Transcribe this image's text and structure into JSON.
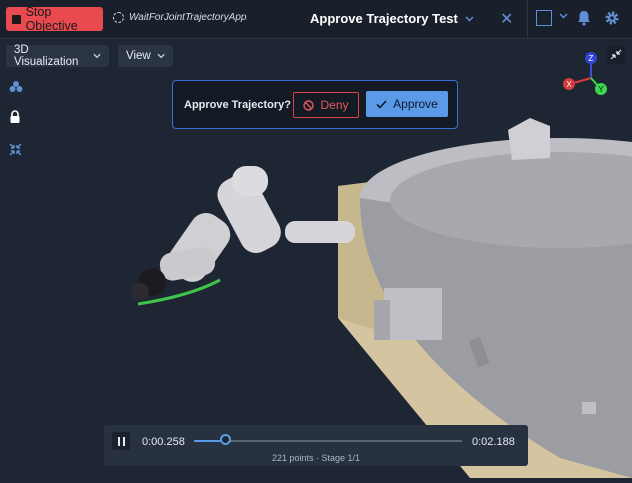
{
  "topbar": {
    "stop_label": "Stop Objective",
    "wait_status": "WaitForJointTrajectoryApproval",
    "title": "Approve Trajectory Test"
  },
  "toolbar": {
    "view_mode": "3D Visualization",
    "view_menu": "View"
  },
  "sidebar_icons": [
    "cluster-icon",
    "lock-icon",
    "collapse-icon"
  ],
  "dialog": {
    "question": "Approve Trajectory?",
    "deny_label": "Deny",
    "approve_label": "Approve"
  },
  "gizmo": {
    "x": "X",
    "y": "Y",
    "z": "Z"
  },
  "playback": {
    "current_time": "0:00.258",
    "end_time": "0:02.188",
    "progress": 0.118,
    "info": "221 points · Stage 1/1"
  },
  "colors": {
    "stop": "#e84a4f",
    "accent": "#5a9ae6",
    "deny": "#d9434a",
    "background": "#1f2633"
  }
}
